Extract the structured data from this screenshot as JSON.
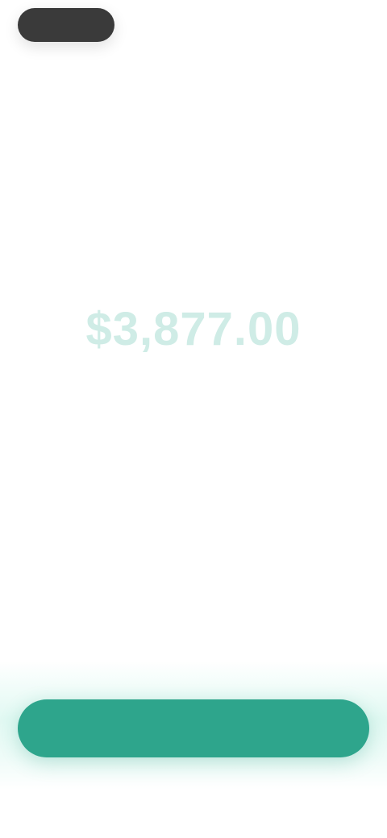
{
  "status_bar": {
    "pill_label": "",
    "right_label": ""
  },
  "main": {
    "amount": "$3,877.00",
    "title": "",
    "body": ""
  },
  "actions": {
    "primary_label": "",
    "secondary_label": ""
  },
  "colors": {
    "accent": "#2ea58c",
    "amount_tint": "#cfece6",
    "glow": "#bef2e4"
  }
}
